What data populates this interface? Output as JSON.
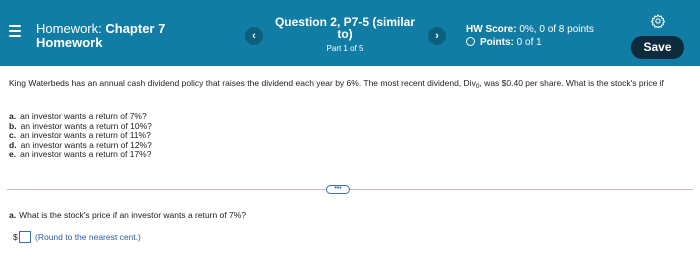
{
  "header": {
    "hw_label": "Homework: ",
    "hw_chapter": "Chapter 7",
    "hw_name": "Homework",
    "question_title_line1": "Question 2, P7-5 (similar",
    "question_title_line2": "to)",
    "part": "Part 1 of 5",
    "prev_glyph": "‹",
    "next_glyph": "›",
    "score_label": "HW Score: ",
    "score_value": "0%, 0 of 8 points",
    "points_label": "Points: ",
    "points_value": "0 of 1",
    "save_label": "Save",
    "header_color": "#127da4",
    "save_color": "#0e2b3d",
    "icons": [
      "menu-icon",
      "prev-arrow-icon",
      "next-arrow-icon",
      "circle-icon",
      "gear-icon"
    ]
  },
  "question": {
    "text_before": "King Waterbeds has an annual cash dividend policy that raises the dividend each year by 6%.  The most recent dividend, Div",
    "sub": "0",
    "text_after": ", was $0.40 per share.  What is the stock's price if",
    "parts": [
      {
        "letter": "a.",
        "text": "an investor wants a return of 7%?"
      },
      {
        "letter": "b.",
        "text": "an investor wants a return of 10%?"
      },
      {
        "letter": "c.",
        "text": "an investor wants a return of 11%?"
      },
      {
        "letter": "d.",
        "text": "an investor wants a return of 12%?"
      },
      {
        "letter": "e.",
        "text": "an investor wants a return of 17%?"
      }
    ]
  },
  "more_label": "•••",
  "ask": {
    "letter": "a.",
    "text": "What is the stock's price if an investor wants a return of 7%?"
  },
  "answer": {
    "currency": "$",
    "value": "",
    "hint": "(Round to the nearest cent.)"
  }
}
